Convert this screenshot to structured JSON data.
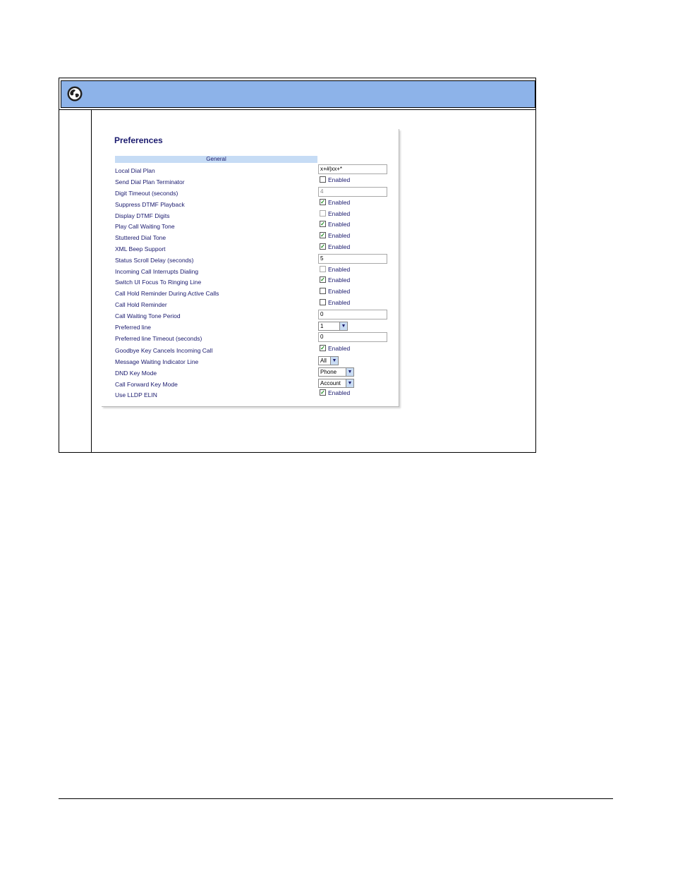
{
  "panel": {
    "title": "Preferences",
    "section": "General"
  },
  "rows": [
    {
      "label": "Local Dial Plan",
      "kind": "text",
      "value": "x+#|xx+*"
    },
    {
      "label": "Send Dial Plan Terminator",
      "kind": "check",
      "checked": false,
      "option": "Enabled"
    },
    {
      "label": "Digit Timeout (seconds)",
      "kind": "text",
      "value": "4",
      "disabled": true
    },
    {
      "label": "Suppress DTMF Playback",
      "kind": "check",
      "checked": true,
      "option": "Enabled"
    },
    {
      "label": "Display DTMF Digits",
      "kind": "check",
      "checked": false,
      "disabled": true,
      "option": "Enabled"
    },
    {
      "label": "Play Call Waiting Tone",
      "kind": "check",
      "checked": true,
      "option": "Enabled"
    },
    {
      "label": "Stuttered Dial Tone",
      "kind": "check",
      "checked": true,
      "option": "Enabled"
    },
    {
      "label": "XML Beep Support",
      "kind": "check",
      "checked": true,
      "option": "Enabled"
    },
    {
      "label": "Status Scroll Delay (seconds)",
      "kind": "text",
      "value": "5"
    },
    {
      "label": "Incoming Call Interrupts Dialing",
      "kind": "check",
      "checked": false,
      "disabled": true,
      "option": "Enabled"
    },
    {
      "label": "Switch UI Focus To Ringing Line",
      "kind": "check",
      "checked": true,
      "option": "Enabled"
    },
    {
      "label": "Call Hold Reminder During Active Calls",
      "kind": "check",
      "checked": false,
      "option": "Enabled"
    },
    {
      "label": "Call Hold Reminder",
      "kind": "check",
      "checked": false,
      "option": "Enabled"
    },
    {
      "label": "Call Waiting Tone Period",
      "kind": "text",
      "value": "0"
    },
    {
      "label": "Preferred line",
      "kind": "select",
      "value": "1"
    },
    {
      "label": "Preferred line Timeout (seconds)",
      "kind": "text",
      "value": "0"
    },
    {
      "label": "Goodbye Key Cancels Incoming Call",
      "kind": "check",
      "checked": true,
      "option": "Enabled"
    },
    {
      "label": "Message Waiting Indicator Line",
      "kind": "select",
      "value": "All"
    },
    {
      "label": "DND Key Mode",
      "kind": "select",
      "value": "Phone"
    },
    {
      "label": "Call Forward Key Mode",
      "kind": "select",
      "value": "Account"
    },
    {
      "label": "Use LLDP ELIN",
      "kind": "check",
      "checked": true,
      "option": "Enabled"
    }
  ],
  "icons": {
    "header": "globe-icon",
    "check_mark": "✓",
    "dropdown": "▼"
  },
  "colors": {
    "header_bg": "#8db3e9",
    "section_bg": "#c6dcf5",
    "label_text": "#1a1a6e"
  }
}
